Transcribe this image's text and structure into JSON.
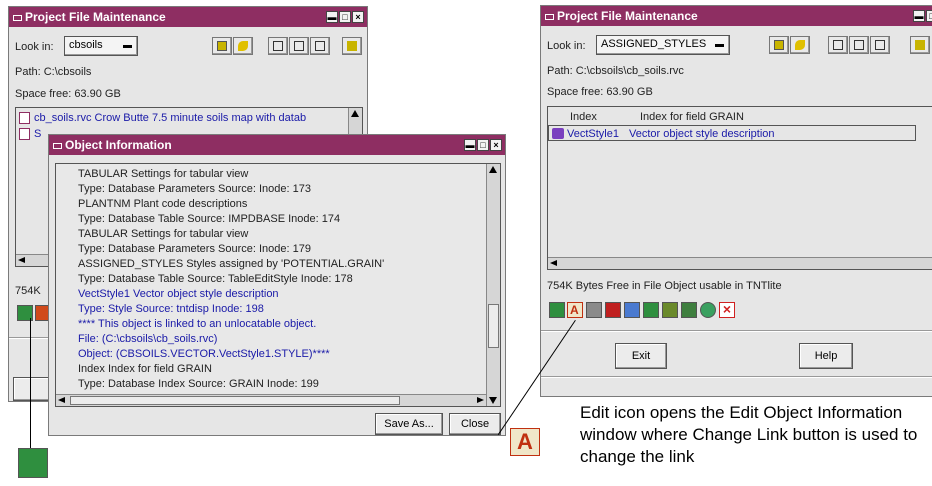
{
  "left_window": {
    "title": "Project File Maintenance",
    "look_in_label": "Look in:",
    "look_in_value": "cbsoils",
    "path": "Path: C:\\cbsoils",
    "space_free": "Space free:  63.90 GB",
    "list_items": [
      "cb_soils.rvc   Crow Butte 7.5 minute soils map with datab",
      "S"
    ],
    "bytes_free_partial": "754K"
  },
  "object_info": {
    "title": "Object Information",
    "lines": [
      {
        "text": "TABULAR       Settings for tabular view",
        "color": "#222222"
      },
      {
        "text": "           Type: Database Parameters  Source:                      Inode: 173",
        "color": "#222222"
      },
      {
        "text": "PLANTNM       Plant code descriptions",
        "color": "#222222"
      },
      {
        "text": "           Type: Database Table  Source: IMPDBASE        Inode: 174",
        "color": "#222222"
      },
      {
        "text": "TABULAR       Settings for tabular view",
        "color": "#222222"
      },
      {
        "text": "           Type: Database Parameters  Source:                      Inode: 179",
        "color": "#222222"
      },
      {
        "text": "ASSIGNED_STYLES  Styles assigned by 'POTENTIAL.GRAIN'",
        "color": "#222222"
      },
      {
        "text": "           Type: Database Table  Source: TableEditStyle   Inode: 178",
        "color": "#222222"
      },
      {
        "text": "VectStyle1      Vector object style description",
        "color": "#1a1aa8"
      },
      {
        "text": "           Type: Style   Source: tntdisp          Inode: 198",
        "color": "#1a1aa8"
      },
      {
        "text": "           **** This object is linked to an unlocatable object.",
        "color": "#1a1aa8"
      },
      {
        "text": "File: (C:\\cbsoils\\cb_soils.rvc)",
        "color": "#1a1aa8"
      },
      {
        "text": "Object: (CBSOILS.VECTOR.VectStyle1.STYLE)****",
        "color": "#1a1aa8"
      },
      {
        "text": "Index          Index for field GRAIN",
        "color": "#222222"
      },
      {
        "text": "           Type: Database Index  Source: GRAIN             Inode: 199",
        "color": "#222222"
      }
    ],
    "save_as_label": "Save As...",
    "close_label": "Close"
  },
  "right_window": {
    "title": "Project File Maintenance",
    "look_in_label": "Look in:",
    "look_in_value": "ASSIGNED_STYLES",
    "path": "Path: C:\\cbsoils\\cb_soils.rvc",
    "space_free": "Space free:  63.90 GB",
    "list_rows": [
      {
        "name": "Index",
        "desc": "Index for field GRAIN"
      },
      {
        "name": "VectStyle1",
        "desc": "Vector object style description"
      }
    ],
    "status": "754K Bytes Free in File    Object usable in TNTlite",
    "exit_label": "Exit",
    "help_label": "Help"
  },
  "caption": "Edit icon opens the Edit Object Information window  where Change Link button is used to change the link",
  "colors": {
    "titlebar": "#8e2e62",
    "link_text": "#1a1aa8",
    "window_bg": "#e6e6e6"
  }
}
